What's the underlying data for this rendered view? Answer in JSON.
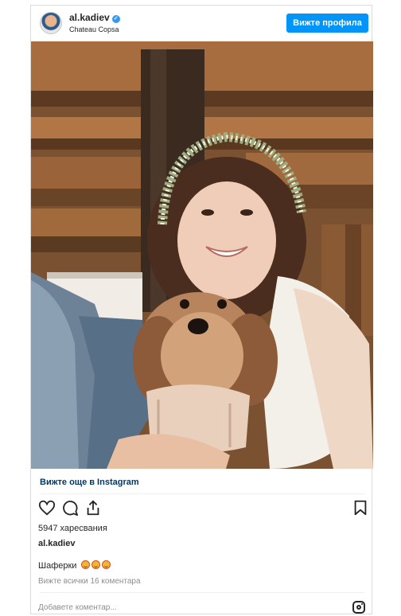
{
  "post": {
    "username": "al.kadiev",
    "location": "Chateau Copsa",
    "view_profile_label": "Вижте профила",
    "view_more_label": "Вижте още в Instagram",
    "likes_label": "5947 харесвания",
    "owner_username": "al.kadiev",
    "caption_text": "Шаферки",
    "view_comments_label": "Вижте всички 16 коментара",
    "add_comment_placeholder": "Добавете коментар..."
  },
  "icons": {
    "like": "heart-icon",
    "comment": "comment-icon",
    "share": "share-icon",
    "save": "bookmark-icon",
    "instagram": "instagram-icon",
    "verified": "verified-badge-icon"
  },
  "colors": {
    "button_blue": "#0095f6",
    "link_blue": "#00376b",
    "muted_text": "#8e8e8e",
    "border": "#dbdbdb"
  },
  "photo": {
    "description_visible": false
  }
}
